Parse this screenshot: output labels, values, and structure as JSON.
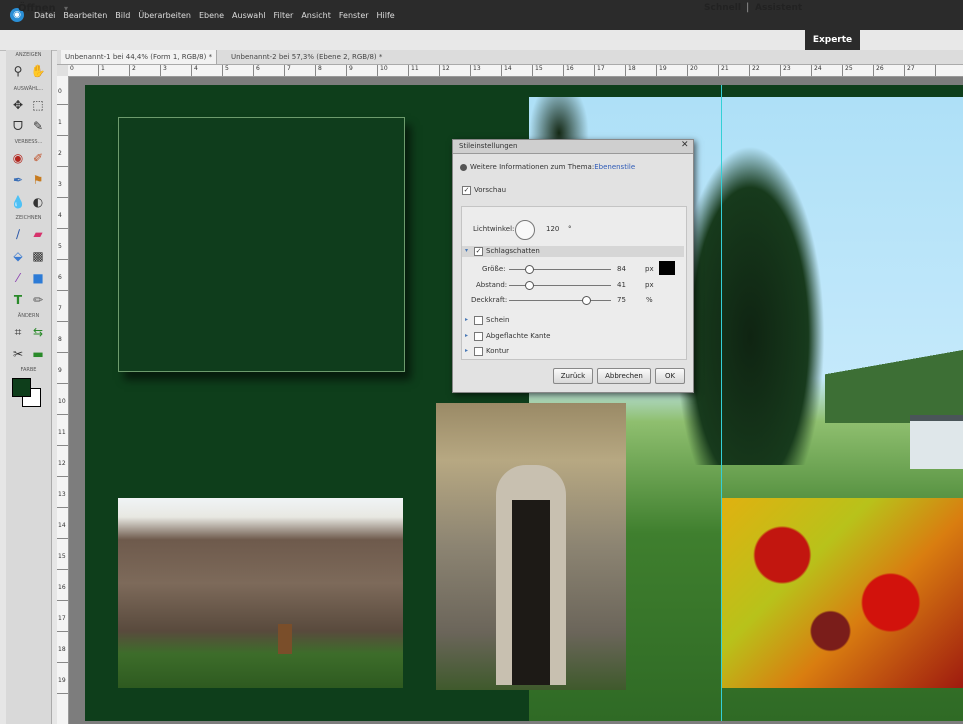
{
  "menubar": {
    "items": [
      "Datei",
      "Bearbeiten",
      "Bild",
      "Überarbeiten",
      "Ebene",
      "Auswahl",
      "Filter",
      "Ansicht",
      "Fenster",
      "Hilfe"
    ]
  },
  "modebar": {
    "open_label": "Öffnen",
    "modes": [
      "Schnell",
      "Assistent",
      "Experte"
    ],
    "active_mode": "Experte"
  },
  "tabs": [
    "Unbenannt-1 bei 44,4% (Form 1, RGB/8) *",
    "Unbenannt-2 bei 57,3% (Ebene 2, RGB/8) *"
  ],
  "toolbox": {
    "sections": [
      "ANZEIGEN",
      "AUSWÄHL...",
      "VERBESS...",
      "ZEICHNEN",
      "ÄNDERN",
      "FARBE"
    ],
    "foreground_color": "#0e3e1b",
    "background_color": "#ffffff"
  },
  "ruler": {
    "h_labels": [
      "0",
      "1",
      "2",
      "3",
      "4",
      "5",
      "6",
      "7",
      "8",
      "9",
      "10",
      "11",
      "12",
      "13",
      "14",
      "15",
      "16",
      "17",
      "18",
      "19",
      "20",
      "21",
      "22",
      "23",
      "24",
      "25",
      "26",
      "27"
    ],
    "v_labels": [
      "0",
      "1",
      "2",
      "3",
      "4",
      "5",
      "6",
      "7",
      "8",
      "9",
      "10",
      "11",
      "12",
      "13",
      "14",
      "15",
      "16",
      "17",
      "18",
      "19"
    ]
  },
  "dialog": {
    "title": "Stileinstellungen",
    "info_prefix": "Weitere Informationen zum Thema:",
    "info_link": "Ebenenstile",
    "preview_label": "Vorschau",
    "preview_checked": true,
    "light_angle_label": "Lichtwinkel:",
    "light_angle_value": "120",
    "light_angle_unit": "°",
    "bevel_label": "Schlagschatten",
    "bevel_checked": true,
    "size_label": "Größe:",
    "size_value": "84",
    "size_unit": "px",
    "distance_label": "Abstand:",
    "distance_value": "41",
    "distance_unit": "px",
    "opacity_label": "Deckkraft:",
    "opacity_value": "75",
    "opacity_unit": "%",
    "glow_label": "Schein",
    "bevel2_label": "Abgeflachte Kante",
    "stroke_label": "Kontur",
    "btn_reset": "Zurück",
    "btn_cancel": "Abbrechen",
    "btn_ok": "OK",
    "shadow_color": "#000000",
    "slider_levels": {
      "size": 0.2,
      "distance": 0.2,
      "opacity": 0.75
    }
  }
}
